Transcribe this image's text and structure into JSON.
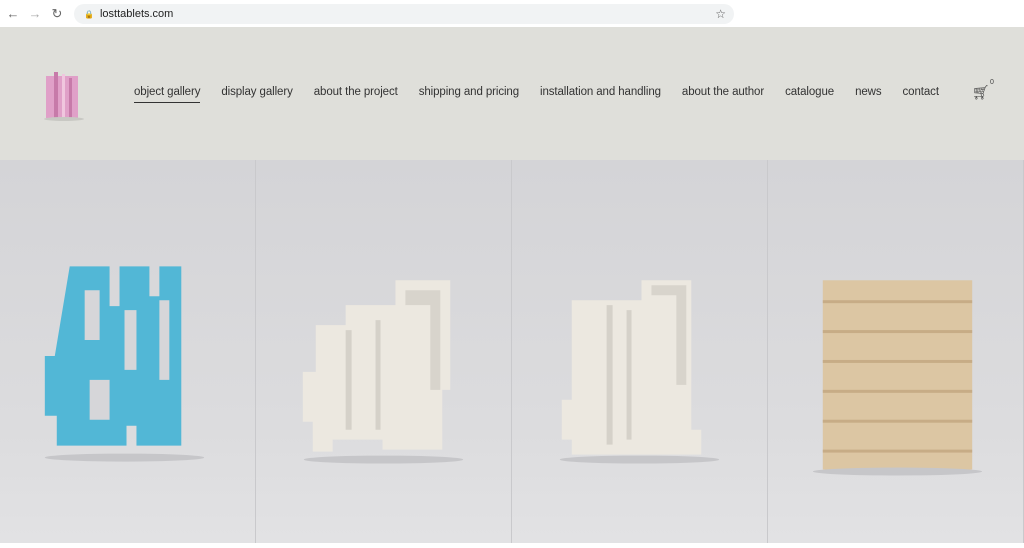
{
  "browser": {
    "url": "losttablets.com",
    "back_icon": "arrow-left-icon",
    "forward_icon": "arrow-right-icon",
    "reload_icon": "reload-icon",
    "bookmark_icon": "star-icon"
  },
  "nav": {
    "items": [
      {
        "label": "object gallery",
        "active": true
      },
      {
        "label": "display gallery"
      },
      {
        "label": "about the project"
      },
      {
        "label": "shipping and pricing"
      },
      {
        "label": "installation and handling"
      },
      {
        "label": "about the author"
      },
      {
        "label": "catalogue"
      },
      {
        "label": "news"
      },
      {
        "label": "contact"
      }
    ],
    "cart_count": "0"
  },
  "colors": {
    "header_bg": "#dfdfda",
    "blue_object": "#52b7d6",
    "white_object": "#ece8e0",
    "wood_object": "#dcc6a3",
    "logo_pink": "#e0a0c8"
  }
}
